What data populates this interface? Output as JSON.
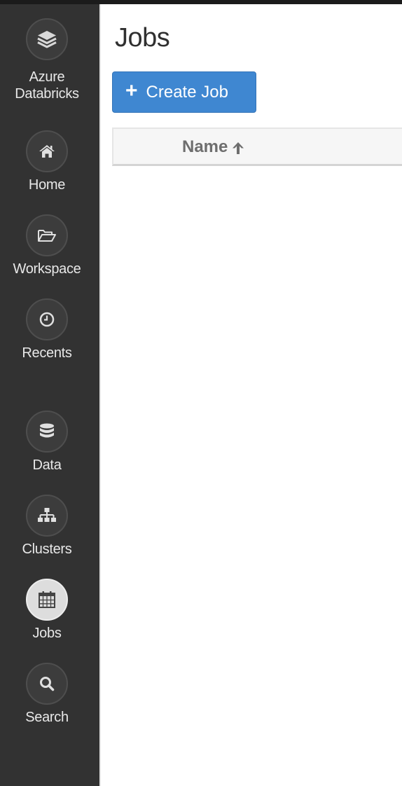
{
  "sidebar": {
    "brand": {
      "label": "Azure Databricks",
      "icon": "layers-icon"
    },
    "items": [
      {
        "label": "Home",
        "icon": "home-icon",
        "active": false
      },
      {
        "label": "Workspace",
        "icon": "folder-open-icon",
        "active": false
      },
      {
        "label": "Recents",
        "icon": "clock-icon",
        "active": false
      },
      {
        "label": "Data",
        "icon": "database-icon",
        "active": false
      },
      {
        "label": "Clusters",
        "icon": "sitemap-icon",
        "active": false
      },
      {
        "label": "Jobs",
        "icon": "calendar-icon",
        "active": true
      },
      {
        "label": "Search",
        "icon": "search-icon",
        "active": false
      }
    ]
  },
  "main": {
    "title": "Jobs",
    "create_button": {
      "label": "Create Job",
      "icon": "plus-icon"
    },
    "table": {
      "columns": [
        {
          "label": "Name",
          "sort": "ascending",
          "sort_icon": "arrow-up-icon"
        }
      ],
      "rows": []
    }
  },
  "colors": {
    "sidebar_bg": "#323232",
    "accent": "#3f87d1",
    "active_nav": "#dddddd"
  }
}
